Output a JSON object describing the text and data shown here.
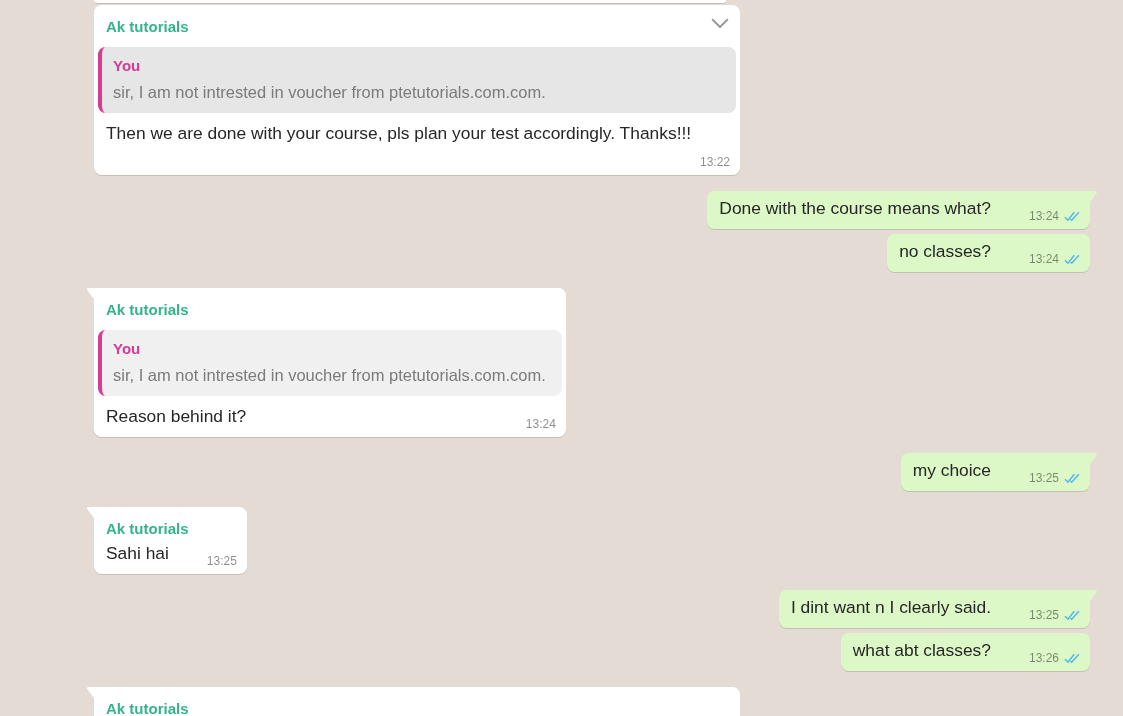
{
  "messages": [
    {
      "outgoing": false,
      "first_in_group": false,
      "menu_visible": true,
      "cut_off": false,
      "sender": "Ak tutorials",
      "quote": {
        "author": "You",
        "text": "sir, I am not intrested in voucher from ptetutorials.com.com."
      },
      "text": "Then we are done with your course, pls plan your test accordingly. Thanks!!!",
      "time": "13:22"
    },
    {
      "outgoing": true,
      "first_in_group": true,
      "menu_visible": false,
      "cut_off": false,
      "text": "Done with the course means what?",
      "time": "13:24",
      "read": true
    },
    {
      "outgoing": true,
      "first_in_group": false,
      "menu_visible": false,
      "cut_off": false,
      "text": "no classes?",
      "time": "13:24",
      "read": true
    },
    {
      "outgoing": false,
      "first_in_group": true,
      "menu_visible": false,
      "cut_off": false,
      "sender": "Ak tutorials",
      "quote": {
        "author": "You",
        "text": "sir, I am not intrested in voucher from ptetutorials.com.com."
      },
      "text": "Reason behind it?",
      "time": "13:24"
    },
    {
      "outgoing": true,
      "first_in_group": true,
      "menu_visible": false,
      "cut_off": false,
      "text": "my choice",
      "time": "13:25",
      "read": true
    },
    {
      "outgoing": false,
      "first_in_group": true,
      "menu_visible": false,
      "cut_off": false,
      "sender": "Ak tutorials",
      "text": "Sahi hai",
      "time": "13:25"
    },
    {
      "outgoing": true,
      "first_in_group": true,
      "menu_visible": false,
      "cut_off": false,
      "text": "I dint want n I clearly said.",
      "time": "13:25",
      "read": true
    },
    {
      "outgoing": true,
      "first_in_group": false,
      "menu_visible": false,
      "cut_off": false,
      "text": "what abt classes?",
      "time": "13:26",
      "read": true
    },
    {
      "outgoing": false,
      "first_in_group": true,
      "menu_visible": false,
      "cut_off": true,
      "sender": "Ak tutorials"
    }
  ]
}
